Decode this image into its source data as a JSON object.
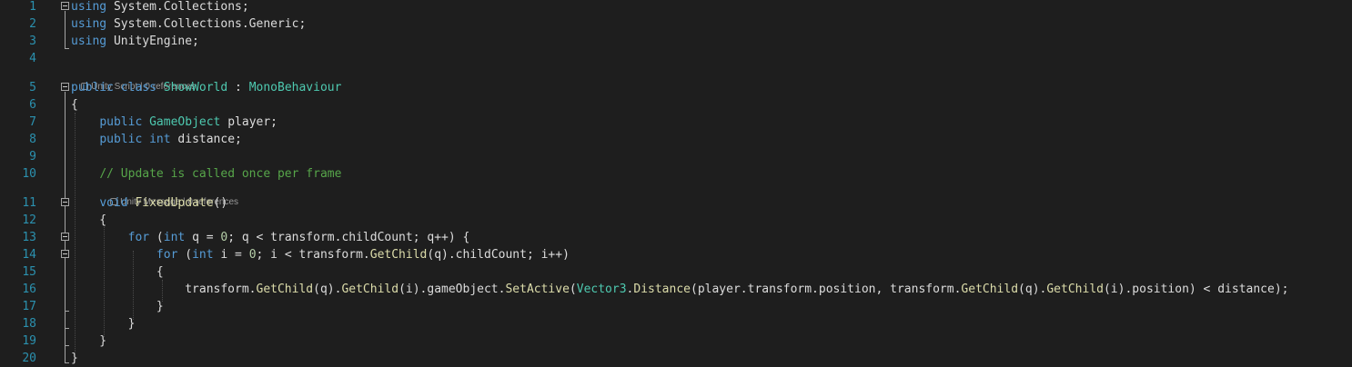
{
  "colors": {
    "background": "#1e1e1e",
    "line_number": "#2b91af",
    "keyword": "#569cd6",
    "type": "#4ec9b0",
    "method": "#dcdcaa",
    "comment": "#57a64a",
    "number": "#b5cea8",
    "text": "#dcdcdc"
  },
  "line_numbers": [
    "1",
    "2",
    "3",
    "4",
    "5",
    "6",
    "7",
    "8",
    "9",
    "10",
    "11",
    "12",
    "13",
    "14",
    "15",
    "16",
    "17",
    "18",
    "19",
    "20"
  ],
  "codelens": {
    "class_lens": {
      "kind": "Unity Script",
      "sep": " | ",
      "refs": "0 references",
      "icon": "unity-cube-icon"
    },
    "method_lens": {
      "kind": "Unity Message",
      "sep": " | ",
      "refs": "0 references",
      "icon": "unity-cube-icon"
    }
  },
  "lines": [
    [
      {
        "c": "kw",
        "t": "using"
      },
      {
        "c": "id",
        "t": " System.Collections;"
      }
    ],
    [
      {
        "c": "kw",
        "t": "using"
      },
      {
        "c": "id",
        "t": " System.Collections.Generic;"
      }
    ],
    [
      {
        "c": "kw",
        "t": "using"
      },
      {
        "c": "id",
        "t": " UnityEngine;"
      }
    ],
    [],
    [
      {
        "c": "kw",
        "t": "public class "
      },
      {
        "c": "ty",
        "t": "ShowWorld"
      },
      {
        "c": "id",
        "t": " : "
      },
      {
        "c": "ty",
        "t": "MonoBehaviour"
      }
    ],
    [
      {
        "c": "id",
        "t": "{"
      }
    ],
    [
      {
        "c": "id",
        "t": "    "
      },
      {
        "c": "kw",
        "t": "public "
      },
      {
        "c": "ty",
        "t": "GameObject"
      },
      {
        "c": "id",
        "t": " player;"
      }
    ],
    [
      {
        "c": "id",
        "t": "    "
      },
      {
        "c": "kw",
        "t": "public int"
      },
      {
        "c": "id",
        "t": " distance;"
      }
    ],
    [],
    [
      {
        "c": "id",
        "t": "    "
      },
      {
        "c": "cm",
        "t": "// Update is called once per frame"
      }
    ],
    [
      {
        "c": "id",
        "t": "    "
      },
      {
        "c": "kw",
        "t": "void "
      },
      {
        "c": "mt",
        "t": "FixedUpdate"
      },
      {
        "c": "id",
        "t": "()"
      }
    ],
    [
      {
        "c": "id",
        "t": "    {"
      }
    ],
    [
      {
        "c": "id",
        "t": "        "
      },
      {
        "c": "kw",
        "t": "for"
      },
      {
        "c": "id",
        "t": " ("
      },
      {
        "c": "kw",
        "t": "int"
      },
      {
        "c": "id",
        "t": " q = "
      },
      {
        "c": "nm",
        "t": "0"
      },
      {
        "c": "id",
        "t": "; q < transform.childCount; q++) {"
      }
    ],
    [
      {
        "c": "id",
        "t": "            "
      },
      {
        "c": "kw",
        "t": "for"
      },
      {
        "c": "id",
        "t": " ("
      },
      {
        "c": "kw",
        "t": "int"
      },
      {
        "c": "id",
        "t": " i = "
      },
      {
        "c": "nm",
        "t": "0"
      },
      {
        "c": "id",
        "t": "; i < transform."
      },
      {
        "c": "mt",
        "t": "GetChild"
      },
      {
        "c": "id",
        "t": "(q).childCount; i++)"
      }
    ],
    [
      {
        "c": "id",
        "t": "            {"
      }
    ],
    [
      {
        "c": "id",
        "t": "                transform."
      },
      {
        "c": "mt",
        "t": "GetChild"
      },
      {
        "c": "id",
        "t": "(q)."
      },
      {
        "c": "mt",
        "t": "GetChild"
      },
      {
        "c": "id",
        "t": "(i).gameObject."
      },
      {
        "c": "mt",
        "t": "SetActive"
      },
      {
        "c": "id",
        "t": "("
      },
      {
        "c": "ty",
        "t": "Vector3"
      },
      {
        "c": "id",
        "t": "."
      },
      {
        "c": "mt",
        "t": "Distance"
      },
      {
        "c": "id",
        "t": "(player.transform.position, transform."
      },
      {
        "c": "mt",
        "t": "GetChild"
      },
      {
        "c": "id",
        "t": "(q)."
      },
      {
        "c": "mt",
        "t": "GetChild"
      },
      {
        "c": "id",
        "t": "(i).position) < distance);"
      }
    ],
    [
      {
        "c": "id",
        "t": "            }"
      }
    ],
    [
      {
        "c": "id",
        "t": "        }"
      }
    ],
    [
      {
        "c": "id",
        "t": "    }"
      }
    ],
    [
      {
        "c": "id",
        "t": "}"
      }
    ]
  ]
}
